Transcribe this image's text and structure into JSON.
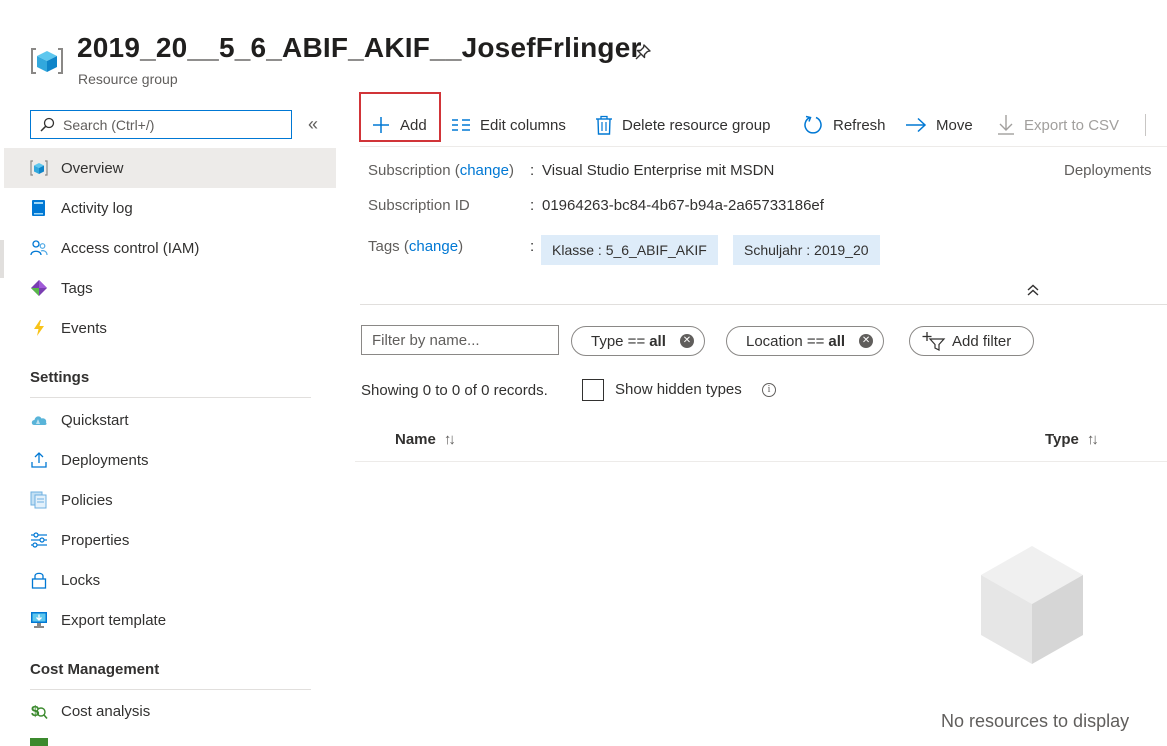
{
  "header": {
    "title": "2019_20__5_6_ABIF_AKIF__JosefFrlinger",
    "subtitle": "Resource group",
    "icon": "resource-group-cube-icon"
  },
  "sidebar": {
    "search_placeholder": "Search (Ctrl+/)",
    "collapse_glyph": "«",
    "items": [
      {
        "label": "Overview",
        "icon": "overview-cube-icon",
        "active": true
      },
      {
        "label": "Activity log",
        "icon": "activity-log-icon"
      },
      {
        "label": "Access control (IAM)",
        "icon": "people-icon"
      },
      {
        "label": "Tags",
        "icon": "tag-icon"
      },
      {
        "label": "Events",
        "icon": "lightning-icon"
      }
    ],
    "settings_title": "Settings",
    "settings_items": [
      {
        "label": "Quickstart",
        "icon": "cloud-icon"
      },
      {
        "label": "Deployments",
        "icon": "upload-icon"
      },
      {
        "label": "Policies",
        "icon": "policy-doc-icon"
      },
      {
        "label": "Properties",
        "icon": "sliders-icon"
      },
      {
        "label": "Locks",
        "icon": "lock-icon"
      },
      {
        "label": "Export template",
        "icon": "monitor-download-icon"
      }
    ],
    "cost_title": "Cost Management",
    "cost_items": [
      {
        "label": "Cost analysis",
        "icon": "cost-analysis-icon"
      }
    ]
  },
  "toolbar": {
    "add": "Add",
    "edit_columns": "Edit columns",
    "delete_rg": "Delete resource group",
    "refresh": "Refresh",
    "move": "Move",
    "export_csv": "Export to CSV"
  },
  "essentials": {
    "subscription_label": "Subscription",
    "change": "change",
    "subscription_value": "Visual Studio Enterprise mit MSDN",
    "subscription_id_label": "Subscription ID",
    "subscription_id_value": "01964263-bc84-4b67-b94a-2a65733186ef",
    "tags_label": "Tags",
    "tags": [
      "Klasse : 5_6_ABIF_AKIF",
      "Schuljahr : 2019_20"
    ],
    "deployments_label": "Deployments",
    "colon": ":"
  },
  "filters": {
    "name_placeholder": "Filter by name...",
    "type_pill_prefix": "Type ==",
    "type_pill_value": "all",
    "location_pill_prefix": "Location ==",
    "location_pill_value": "all",
    "add_filter": "Add filter"
  },
  "records": {
    "showing_text": "Showing 0 to 0 of 0 records.",
    "show_hidden": "Show hidden types",
    "info_glyph": "i"
  },
  "table": {
    "col_name": "Name",
    "col_type": "Type",
    "sort_glyph": "↑↓"
  },
  "empty_state": {
    "text": "No resources to display"
  },
  "colors": {
    "accent": "#0078d4",
    "highlight_border": "#d13438",
    "tag_bg": "#deecf9"
  }
}
